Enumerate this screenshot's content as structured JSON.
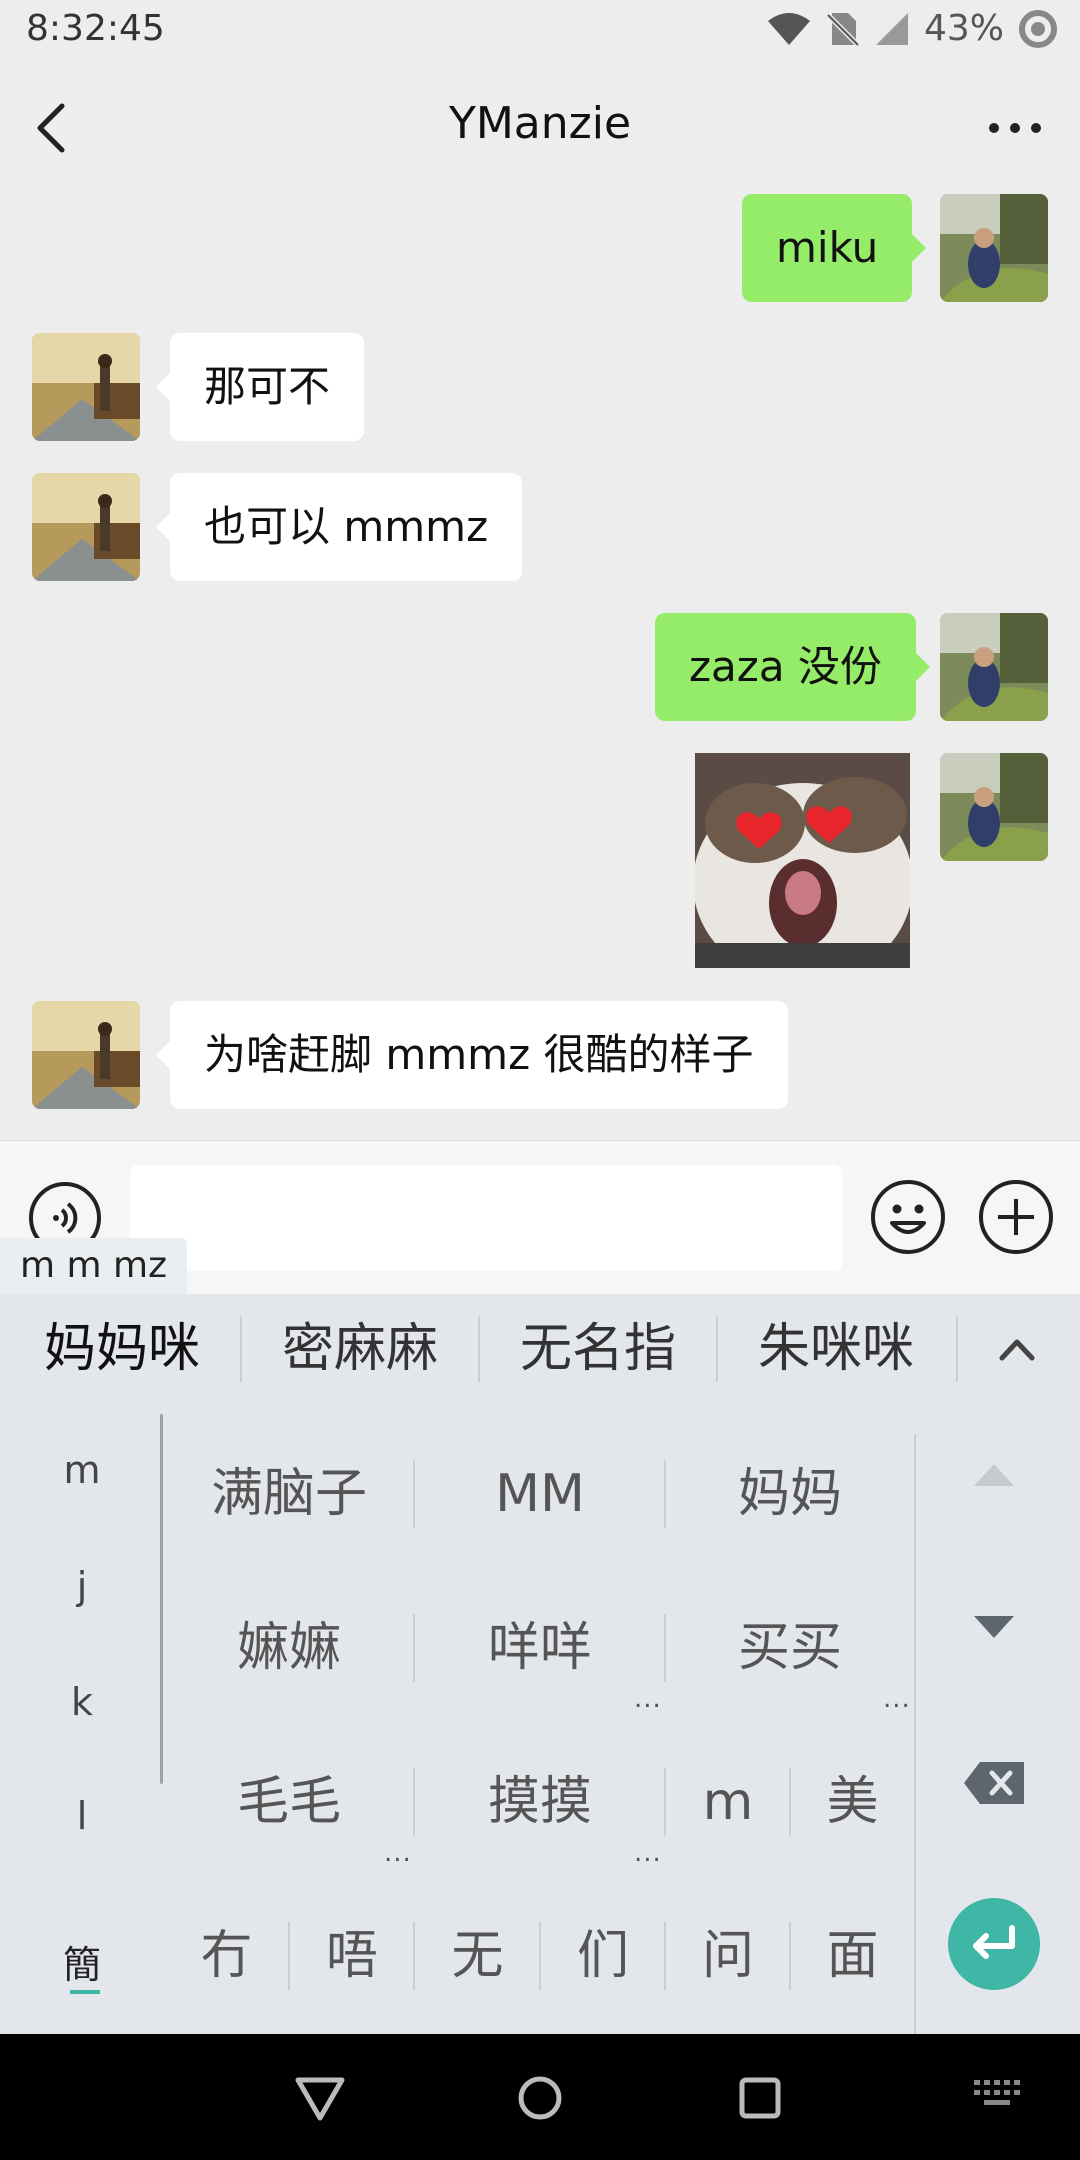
{
  "status": {
    "time": "8:32:45",
    "battery": "43%"
  },
  "header": {
    "title": "YManzie"
  },
  "messages": [
    {
      "side": "out",
      "text": "miku"
    },
    {
      "side": "in",
      "text": "那可不"
    },
    {
      "side": "in",
      "text": "也可以 mmmz"
    },
    {
      "side": "out",
      "text": "zaza 没份"
    },
    {
      "side": "out",
      "type": "sticker",
      "text": ""
    },
    {
      "side": "in",
      "text": "为啥赶脚 mmmz 很酷的样子"
    }
  ],
  "input": {
    "value": "",
    "composition": "m m mz"
  },
  "keyboard": {
    "candidates": [
      "妈妈咪",
      "密麻麻",
      "无名指",
      "朱咪咪"
    ],
    "pinyin_options": [
      "m",
      "j",
      "k",
      "l"
    ],
    "script_toggle": "簡",
    "grid_rows": [
      [
        "满脑子",
        "MM",
        "妈妈"
      ],
      [
        "嫲嫲",
        "咩咩",
        "买买"
      ],
      [
        "毛毛",
        "摸摸",
        "m",
        "美"
      ],
      [
        "冇",
        "唔",
        "无",
        "们",
        "问",
        "面"
      ]
    ],
    "more_indicator": "..."
  },
  "colors": {
    "sent_bubble": "#95ec69",
    "received_bubble": "#ffffff",
    "enter_key": "#3fb6a6",
    "chat_background": "#ededed"
  }
}
